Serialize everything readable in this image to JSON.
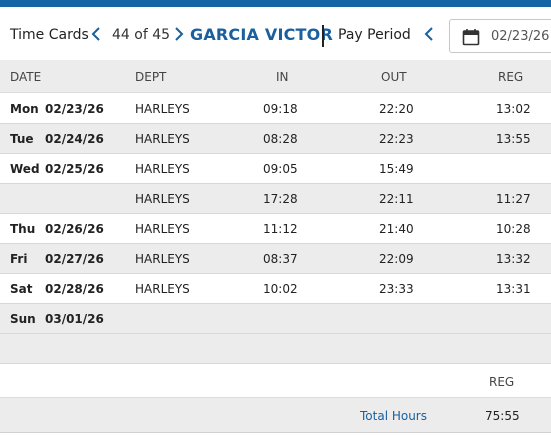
{
  "header": {
    "title": "Time Cards",
    "position": "44 of 45",
    "employee_name": "GARCIA VICTOR",
    "pay_period_label": "Pay Period",
    "date_value": "02/23/26",
    "accent_color": "#1a5f9e"
  },
  "columns": {
    "date": "DATE",
    "dept": "DEPT",
    "in": "IN",
    "out": "OUT",
    "reg": "REG"
  },
  "rows": [
    {
      "dow": "Mon",
      "date": "02/23/26",
      "dept": "HARLEYS",
      "in": "09:18",
      "out": "22:20",
      "reg": "13:02"
    },
    {
      "dow": "Tue",
      "date": "02/24/26",
      "dept": "HARLEYS",
      "in": "08:28",
      "out": "22:23",
      "reg": "13:55"
    },
    {
      "dow": "Wed",
      "date": "02/25/26",
      "dept": "HARLEYS",
      "in": "09:05",
      "out": "15:49",
      "reg": ""
    },
    {
      "dow": "",
      "date": "",
      "dept": "HARLEYS",
      "in": "17:28",
      "out": "22:11",
      "reg": "11:27"
    },
    {
      "dow": "Thu",
      "date": "02/26/26",
      "dept": "HARLEYS",
      "in": "11:12",
      "out": "21:40",
      "reg": "10:28"
    },
    {
      "dow": "Fri",
      "date": "02/27/26",
      "dept": "HARLEYS",
      "in": "08:37",
      "out": "22:09",
      "reg": "13:32"
    },
    {
      "dow": "Sat",
      "date": "02/28/26",
      "dept": "HARLEYS",
      "in": "10:02",
      "out": "23:33",
      "reg": "13:31"
    },
    {
      "dow": "Sun",
      "date": "03/01/26",
      "dept": "",
      "in": "",
      "out": "",
      "reg": ""
    }
  ],
  "summary": {
    "reg_header": "REG",
    "total_label": "Total Hours",
    "total_value": "75:55"
  }
}
